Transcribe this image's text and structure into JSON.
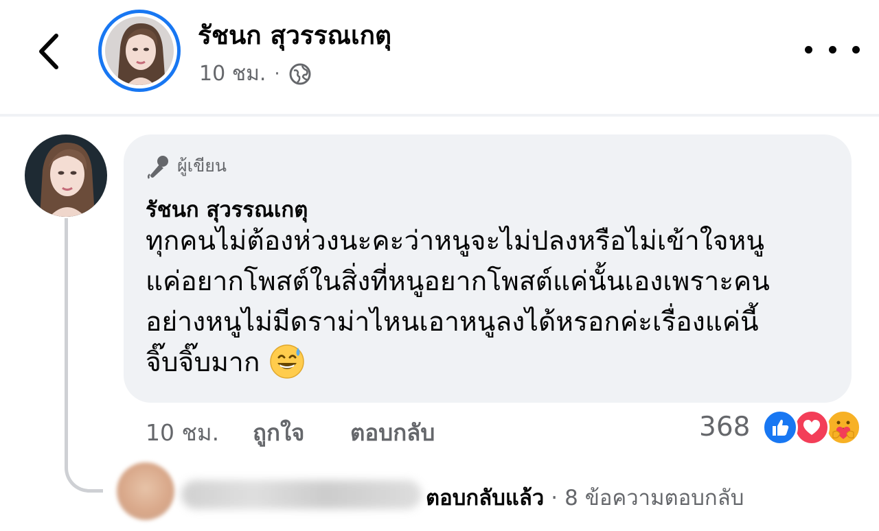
{
  "header": {
    "back_icon": "chevron-left-icon",
    "name": "รัชนก สุวรรณเกตุ",
    "time": "10 ชม.",
    "separator": "·",
    "privacy_icon": "globe-icon",
    "more_icon": "more-dots-icon"
  },
  "comment": {
    "badge_icon": "microphone-icon",
    "badge_label": "ผู้เขียน",
    "author": "รัชนก สุวรรณเกตุ",
    "lines": [
      "ทุกคนไม่ต้องห่วงนะคะว่าหนูจะไม่ปลงหรือไม่เข้าใจหนู",
      "แค่อยากโพสต์ในสิ่งที่หนูอยากโพสต์แค่นั้นเองเพราะคน",
      "อย่างหนูไม่มีดราม่าไหนเอาหนูลงได้หรอกค่ะเรื่องแค่นี้",
      "จิ๊บจิ๊บมาก"
    ],
    "emoji": "grinning-sweat-emoji",
    "time": "10 ชม.",
    "like_label": "ถูกใจ",
    "reply_label": "ตอบกลับ",
    "reaction_count": "368",
    "reactions": [
      "like-reaction-icon",
      "love-reaction-icon",
      "care-reaction-icon"
    ]
  },
  "replies": {
    "status": "ตอบกลับแล้ว",
    "separator": "·",
    "count_text": "8 ข้อความตอบกลับ"
  },
  "colors": {
    "accent": "#1877f2",
    "bubble": "#f0f2f5",
    "secondary_text": "#65676b",
    "love": "#f33e58",
    "care": "#f7b125"
  }
}
